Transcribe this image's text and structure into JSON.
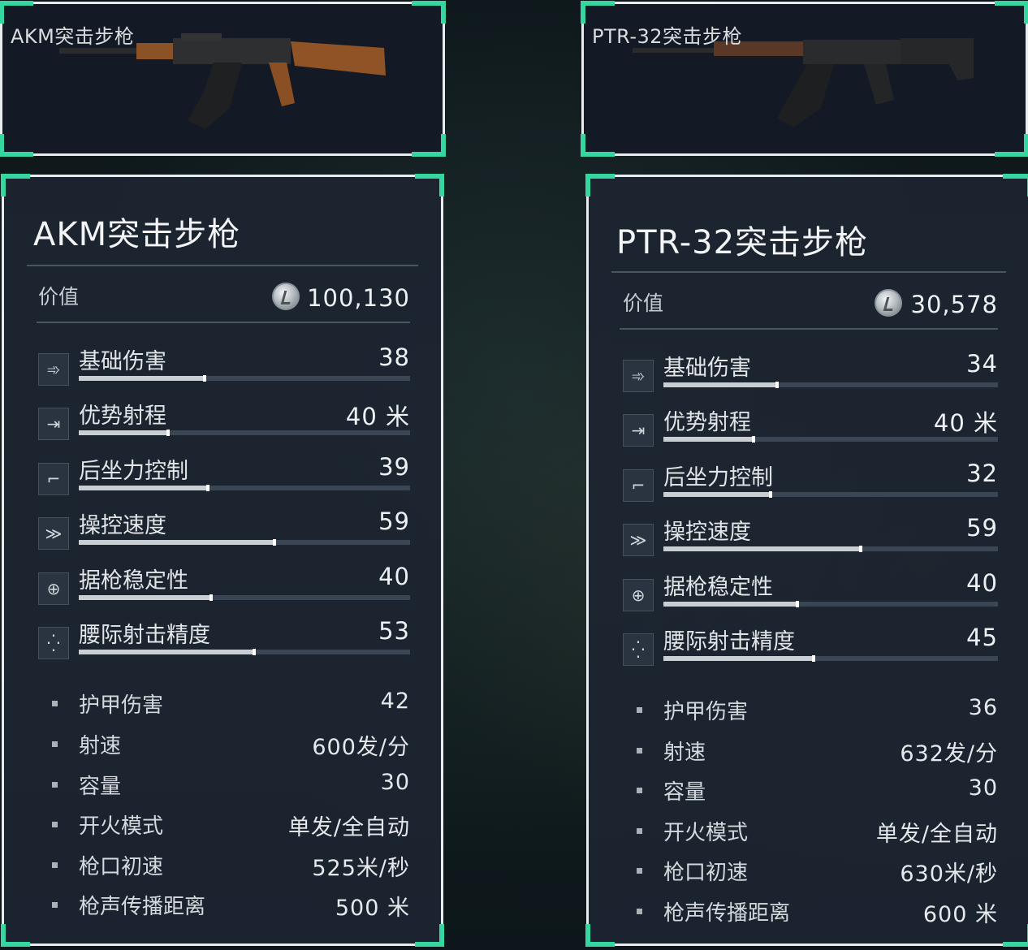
{
  "colors": {
    "accent": "#35d6a0",
    "frame": "#e8ecef",
    "panel": "#1c2530"
  },
  "value_label": "价值",
  "weapons": [
    {
      "image_label": "AKM突击步枪",
      "name": "AKM突击步枪",
      "value": "100,130",
      "attributes": [
        {
          "icon": "damage-icon",
          "label": "基础伤害",
          "value": "38",
          "level": 0.38
        },
        {
          "icon": "range-icon",
          "label": "优势射程",
          "value": "40 米",
          "level": 0.27
        },
        {
          "icon": "recoil-icon",
          "label": "后坐力控制",
          "value": "39",
          "level": 0.39
        },
        {
          "icon": "handling-icon",
          "label": "操控速度",
          "value": "59",
          "level": 0.59
        },
        {
          "icon": "stability-icon",
          "label": "据枪稳定性",
          "value": "40",
          "level": 0.4
        },
        {
          "icon": "hipfire-icon",
          "label": "腰际射击精度",
          "value": "53",
          "level": 0.53
        }
      ],
      "specs": [
        {
          "label": "护甲伤害",
          "value": "42"
        },
        {
          "label": "射速",
          "value": "600发/分"
        },
        {
          "label": "容量",
          "value": "30"
        },
        {
          "label": "开火模式",
          "value": "单发/全自动"
        },
        {
          "label": "枪口初速",
          "value": "525米/秒"
        },
        {
          "label": "枪声传播距离",
          "value": "500 米"
        }
      ]
    },
    {
      "image_label": "PTR-32突击步枪",
      "name": "PTR-32突击步枪",
      "value": "30,578",
      "attributes": [
        {
          "icon": "damage-icon",
          "label": "基础伤害",
          "value": "34",
          "level": 0.34
        },
        {
          "icon": "range-icon",
          "label": "优势射程",
          "value": "40 米",
          "level": 0.27
        },
        {
          "icon": "recoil-icon",
          "label": "后坐力控制",
          "value": "32",
          "level": 0.32
        },
        {
          "icon": "handling-icon",
          "label": "操控速度",
          "value": "59",
          "level": 0.59
        },
        {
          "icon": "stability-icon",
          "label": "据枪稳定性",
          "value": "40",
          "level": 0.4
        },
        {
          "icon": "hipfire-icon",
          "label": "腰际射击精度",
          "value": "45",
          "level": 0.45
        }
      ],
      "specs": [
        {
          "label": "护甲伤害",
          "value": "36"
        },
        {
          "label": "射速",
          "value": "632发/分"
        },
        {
          "label": "容量",
          "value": "30"
        },
        {
          "label": "开火模式",
          "value": "单发/全自动"
        },
        {
          "label": "枪口初速",
          "value": "630米/秒"
        },
        {
          "label": "枪声传播距离",
          "value": "600 米"
        }
      ]
    }
  ]
}
